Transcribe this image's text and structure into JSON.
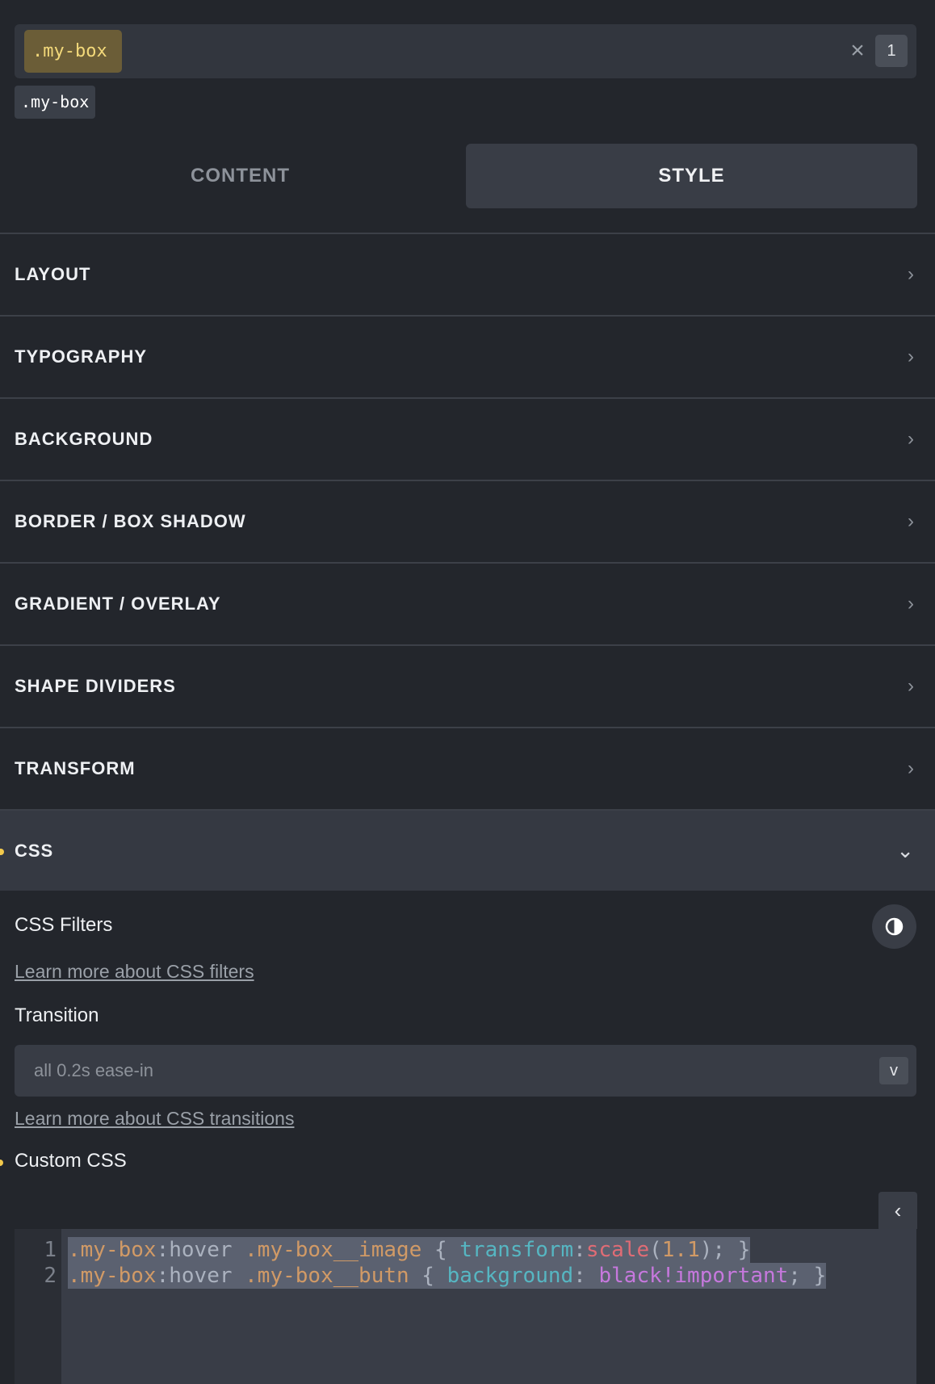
{
  "selector": {
    "active_chip": ".my-box",
    "clear_icon": "×",
    "count": "1",
    "suggestion_chip": ".my-box"
  },
  "tabs": [
    {
      "label": "CONTENT",
      "active": false
    },
    {
      "label": "STYLE",
      "active": true
    }
  ],
  "panels": [
    {
      "label": "LAYOUT"
    },
    {
      "label": "TYPOGRAPHY"
    },
    {
      "label": "BACKGROUND"
    },
    {
      "label": "BORDER / BOX SHADOW"
    },
    {
      "label": "GRADIENT / OVERLAY"
    },
    {
      "label": "SHAPE DIVIDERS"
    },
    {
      "label": "TRANSFORM"
    },
    {
      "label": "CSS",
      "expanded": true
    }
  ],
  "icons": {
    "chevron_right": "›",
    "chevron_down": "⌄",
    "chevron_left": "‹",
    "filters": "half-circle-icon"
  },
  "css_panel": {
    "filters_label": "CSS Filters",
    "filters_link": "Learn more about CSS filters",
    "transition_label": "Transition",
    "transition_placeholder": "all 0.2s ease-in",
    "transition_toggle": "v",
    "transition_link": "Learn more about CSS transitions",
    "custom_css_label": "Custom CSS",
    "code_lines": [
      {
        "num": "1",
        "parts": [
          {
            "t": ".my-box",
            "c": "t-sel"
          },
          {
            "t": ":hover ",
            "c": "t-pseudo"
          },
          {
            "t": ".my-box__image",
            "c": "t-sel"
          },
          {
            "t": " { ",
            "c": "t-brace"
          },
          {
            "t": "transform",
            "c": "t-prop"
          },
          {
            "t": ":",
            "c": "t-brace"
          },
          {
            "t": "scale",
            "c": "t-fn"
          },
          {
            "t": "(",
            "c": "t-brace"
          },
          {
            "t": "1.1",
            "c": "t-num"
          },
          {
            "t": "); }",
            "c": "t-brace"
          }
        ]
      },
      {
        "num": "2",
        "parts": [
          {
            "t": ".my-box",
            "c": "t-sel"
          },
          {
            "t": ":hover ",
            "c": "t-pseudo"
          },
          {
            "t": ".my-box__butn",
            "c": "t-sel"
          },
          {
            "t": " { ",
            "c": "t-brace"
          },
          {
            "t": "background",
            "c": "t-prop"
          },
          {
            "t": ": ",
            "c": "t-brace"
          },
          {
            "t": "black!important",
            "c": "t-kw"
          },
          {
            "t": "; }",
            "c": "t-brace"
          }
        ]
      }
    ]
  },
  "colors": {
    "background": "#23262c",
    "accent_chip": "#6b5d37",
    "accent_text": "#f3d97a",
    "indicator": "#f2c94c"
  }
}
